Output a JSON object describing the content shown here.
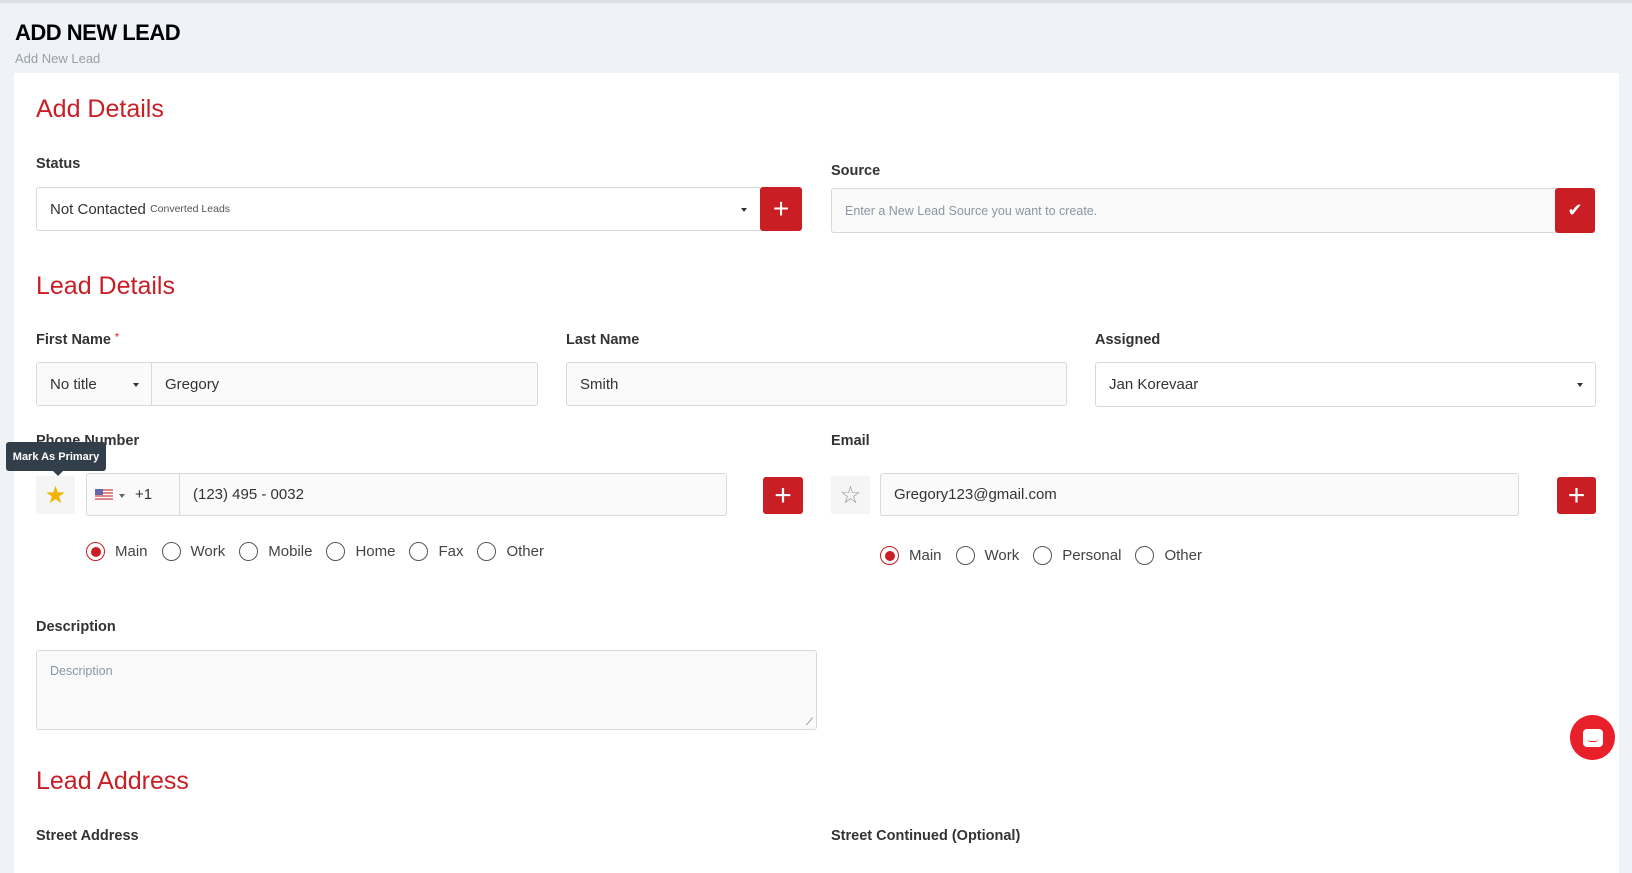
{
  "header": {
    "title": "ADD NEW LEAD",
    "breadcrumb": "Add New Lead"
  },
  "add_details": {
    "title": "Add Details",
    "status_label": "Status",
    "status_value": "Not Contacted",
    "status_group": "Converted Leads",
    "source_label": "Source",
    "source_placeholder": "Enter a New Lead Source you want to create."
  },
  "lead_details": {
    "title": "Lead Details",
    "first_name_label": "First Name",
    "required_mark": "*",
    "title_select": "No title",
    "first_name": "Gregory",
    "last_name_label": "Last Name",
    "last_name": "Smith",
    "assigned_label": "Assigned",
    "assigned": "Jan Korevaar",
    "phone_label": "Phone Number",
    "tooltip": "Mark As Primary",
    "country_code": "+1",
    "phone": "(123) 495 - 0032",
    "phone_types": [
      "Main",
      "Work",
      "Mobile",
      "Home",
      "Fax",
      "Other"
    ],
    "phone_type_selected": "Main",
    "email_label": "Email",
    "email": "Gregory123@gmail.com",
    "email_types": [
      "Main",
      "Work",
      "Personal",
      "Other"
    ],
    "email_type_selected": "Main",
    "description_label": "Description",
    "description_placeholder": "Description"
  },
  "lead_address": {
    "title": "Lead Address",
    "street_label": "Street Address",
    "street2_label": "Street Continued (Optional)"
  },
  "colors": {
    "accent": "#c81e24",
    "star": "#f0b400"
  }
}
